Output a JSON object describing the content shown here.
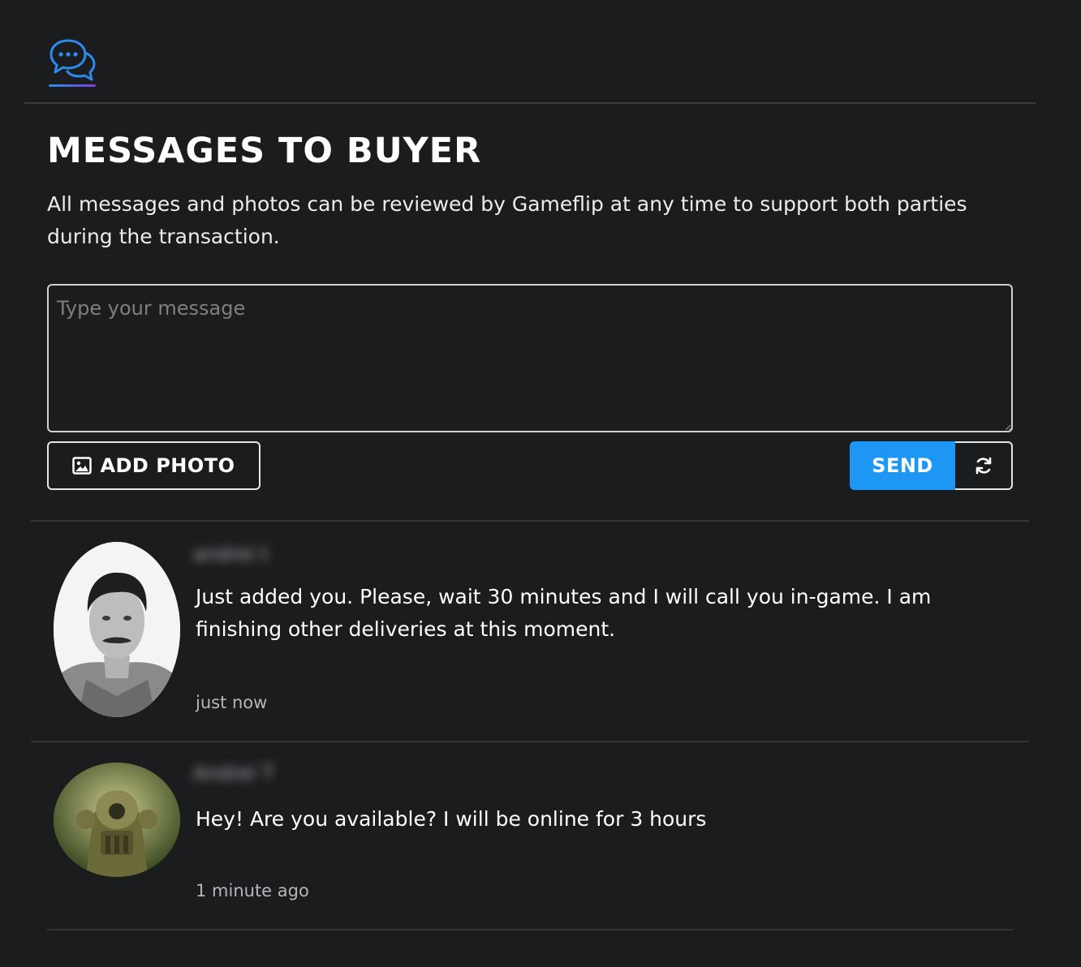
{
  "header": {
    "chat_tab_icon": "chat-bubbles-icon",
    "accent_color": "#1e96f3"
  },
  "page": {
    "title": "MESSAGES TO BUYER",
    "subtitle": "All messages and photos can be reviewed by Gameflip at any time to support both parties during the transaction."
  },
  "composer": {
    "placeholder": "Type your message",
    "value": "",
    "add_photo_label": "ADD PHOTO",
    "add_photo_icon": "image-icon",
    "send_label": "SEND",
    "refresh_icon": "refresh-icon"
  },
  "messages": [
    {
      "sender": "andrei t",
      "text": "Just added you. Please, wait 30 minutes and I will call you in-game. I am finishing other deliveries at this moment.",
      "time": "just now",
      "avatar": "portrait-photo"
    },
    {
      "sender": "Andrei T",
      "text": "Hey! Are you available? I will be online for 3 hours",
      "time": "1 minute ago",
      "avatar": "armor-helmet-image"
    }
  ]
}
